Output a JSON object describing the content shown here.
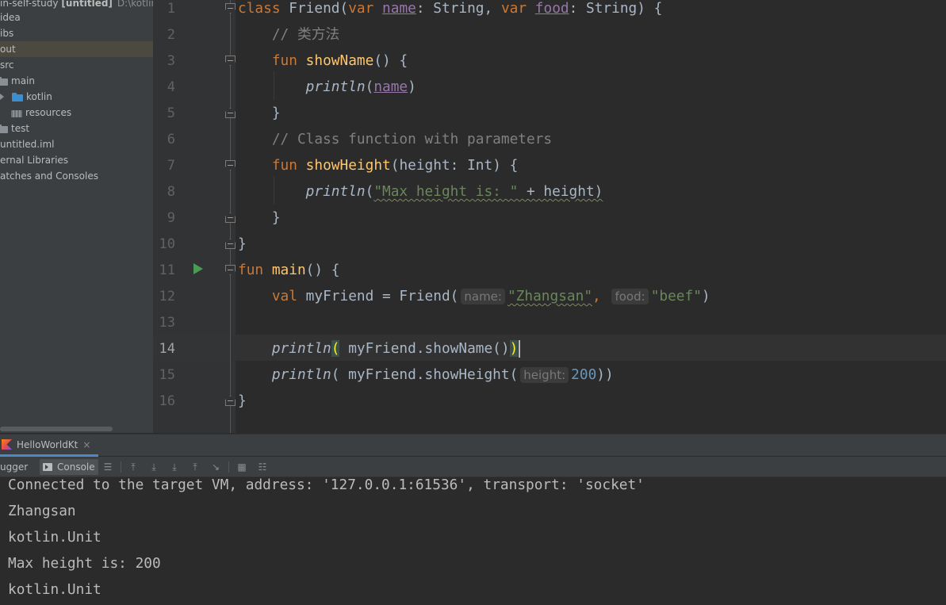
{
  "project_tree": {
    "root_name": "in-self-study",
    "root_bold": "[untitled]",
    "root_path": "D:\\kotlin-",
    "items": [
      {
        "label": "idea"
      },
      {
        "label": "ibs"
      },
      {
        "label": "out"
      },
      {
        "label": "src"
      },
      {
        "label": "main"
      },
      {
        "label": "kotlin"
      },
      {
        "label": "resources"
      },
      {
        "label": "test"
      },
      {
        "label": "untitled.iml"
      },
      {
        "label": "ernal Libraries"
      },
      {
        "label": "atches and Consoles"
      }
    ]
  },
  "editor": {
    "line_numbers": [
      "1",
      "2",
      "3",
      "4",
      "5",
      "6",
      "7",
      "8",
      "9",
      "10",
      "11",
      "12",
      "13",
      "14",
      "15",
      "16"
    ],
    "current_line": "14",
    "code": {
      "l1": {
        "kw_class": "class",
        "cls": "Friend",
        "paren_open": "(",
        "kw_var1": "var",
        "p1": "name",
        "t1": ": String, ",
        "kw_var2": "var",
        "p2": "food",
        "t2": ": String) {"
      },
      "l2": {
        "comment": "// 类方法"
      },
      "l3": {
        "kw": "fun",
        "name": "showName",
        "rest": "() {"
      },
      "l4": {
        "call": "println",
        "open": "(",
        "arg": "name",
        "close": ")"
      },
      "l5": {
        "text": "}"
      },
      "l6": {
        "comment": "// Class function with parameters"
      },
      "l7": {
        "kw": "fun",
        "name": "showHeight",
        "rest": "(height: Int) {"
      },
      "l8": {
        "call": "println",
        "open": "(",
        "str": "\"Max height is: \"",
        "rest": " + height)"
      },
      "l9": {
        "text": "}"
      },
      "l10": {
        "text": "}"
      },
      "l11": {
        "kw": "fun",
        "name": "main",
        "rest": "() {"
      },
      "l12": {
        "kw": "val",
        "pre": "myFriend = Friend(",
        "hint1": "name:",
        "str1": "\"Zhangsan\"",
        "comma": ",",
        "hint2": "food:",
        "str2": "\"beef\"",
        "close": ")"
      },
      "l14": {
        "call": "println",
        "open": "(",
        "mid": " myFriend.showName()",
        "close": ")"
      },
      "l15": {
        "call": "println",
        "pre": "( myFriend.showHeight(",
        "hint": "height:",
        "num": "200",
        "close": "))"
      },
      "l16": {
        "text": "}"
      }
    }
  },
  "run_panel": {
    "tab_label": "HelloWorldKt",
    "tab_close": "×",
    "debugger_label": "ugger",
    "console_label": "Console",
    "output": [
      "Connected to the target VM, address: '127.0.0.1:61536', transport: 'socket'",
      "Zhangsan",
      "kotlin.Unit",
      "Max height is: 200",
      "kotlin.Unit"
    ]
  },
  "colors": {
    "keyword": "#cc7832",
    "function": "#ffc66d",
    "string": "#6a8759",
    "number": "#6897bb",
    "comment": "#808080",
    "property": "#9876aa",
    "run_icon": "#499c54"
  }
}
